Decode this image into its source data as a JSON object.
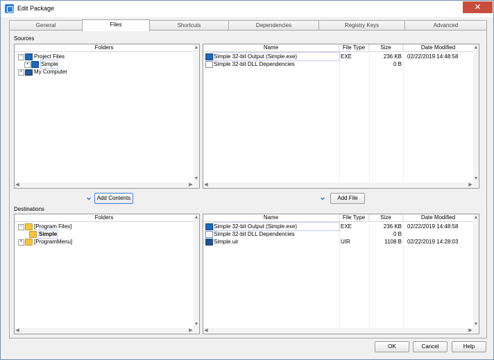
{
  "window": {
    "title": "Edit Package",
    "close_label": "✕"
  },
  "tabs": [
    {
      "label": "General"
    },
    {
      "label": "Files"
    },
    {
      "label": "Shortcuts"
    },
    {
      "label": "Dependencies"
    },
    {
      "label": "Registry Keys"
    },
    {
      "label": "Advanced"
    }
  ],
  "sources": {
    "label": "Sources",
    "folders_header": "Folders",
    "tree": [
      "Project Files",
      "Simple",
      "My Computer"
    ],
    "columns": [
      "Name",
      "File Type",
      "Size",
      "Date Modified"
    ],
    "files": [
      {
        "name": "Simple 32-bit Output (Simple.exe)",
        "type": "EXE",
        "size": "236 KB",
        "date": "02/22/2019 14:48:58"
      },
      {
        "name": "Simple 32-bit DLL Dependencies",
        "type": "",
        "size": "0 B",
        "date": ""
      }
    ]
  },
  "actions": {
    "add_contents": "Add Contents",
    "add_file": "Add File"
  },
  "destinations": {
    "label": "Destinations",
    "folders_header": "Folders",
    "tree": [
      "[Program Files]",
      "Simple",
      "[ProgramMenu]"
    ],
    "columns": [
      "Name",
      "File Type",
      "Size",
      "Date Modified"
    ],
    "files": [
      {
        "name": "Simple 32-bit Output (Simple.exe)",
        "type": "EXE",
        "size": "236 KB",
        "date": "02/22/2019 14:48:58"
      },
      {
        "name": "Simple 32-bit DLL Dependencies",
        "type": "",
        "size": "0 B",
        "date": ""
      },
      {
        "name": "Simple.uir",
        "type": "UIR",
        "size": "1108 B",
        "date": "02/22/2019 14:28:03"
      }
    ]
  },
  "footer": {
    "ok": "OK",
    "cancel": "Cancel",
    "help": "Help"
  }
}
